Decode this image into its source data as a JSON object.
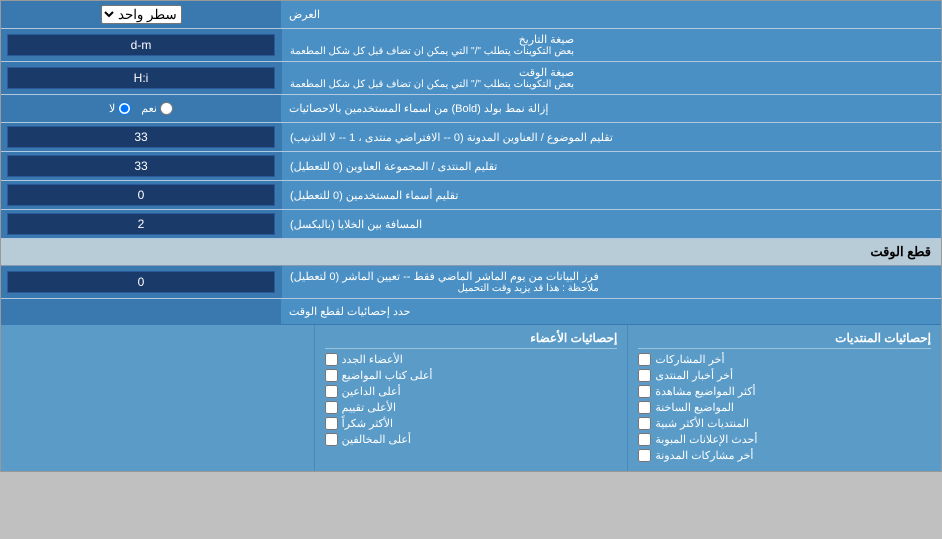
{
  "page": {
    "title": "العرض",
    "display_mode_label": "العرض",
    "display_mode_value": "سطر واحد",
    "date_format_label": "صيغة التاريخ",
    "date_format_sublabel": "بعض التكوينات يتطلب \"/\" التي يمكن ان تضاف قبل كل شكل المطعمة",
    "date_format_value": "d-m",
    "time_format_label": "صيغة الوقت",
    "time_format_sublabel": "بعض التكوينات يتطلب \"/\" التي يمكن ان تضاف قبل كل شكل المطعمة",
    "time_format_value": "H:i",
    "bold_label": "إزالة نمط بولد (Bold) من اسماء المستخدمين بالاحصائيات",
    "bold_yes": "نعم",
    "bold_no": "لا",
    "bold_selected": "no",
    "topics_header_label": "تقليم الموضوع / العناوين المدونة (0 -- الافتراضي منتدى ، 1 -- لا التذنيب)",
    "topics_header_value": "33",
    "forum_header_label": "تقليم المنتدى / المجموعة العناوين (0 للتعطيل)",
    "forum_header_value": "33",
    "usernames_label": "تقليم أسماء المستخدمين (0 للتعطيل)",
    "usernames_value": "0",
    "gap_label": "المسافة بين الخلايا (بالبكسل)",
    "gap_value": "2",
    "cutoff_section": "قطع الوقت",
    "cutoff_label": "فرز البيانات من يوم الماشر الماضي فقط -- تعيين الماشر (0 لتعطيل)",
    "cutoff_sublabel": "ملاحظة : هذا قد يزيد وقت التحميل",
    "cutoff_value": "0",
    "stats_limit_label": "حدد إحصائيات لقطع الوقت",
    "col1_title": "إحصائيات المنتديات",
    "col2_title": "إحصائيات الأعضاء",
    "col1_items": [
      "أخر المشاركات",
      "أخر أخبار المنتدى",
      "أكثر المواضيع مشاهدة",
      "المواضيع الساخنة",
      "المنتديات الأكثر شبية",
      "أحدث الإعلانات المبوبة",
      "أخر مشاركات المدونة"
    ],
    "col2_items": [
      "الأعضاء الجدد",
      "أعلى كتاب المواضيع",
      "أعلى الداعين",
      "الأعلى تقييم",
      "الأكثر شكراً",
      "أعلى المخالفين"
    ],
    "col3_title": "",
    "col3_items": []
  }
}
